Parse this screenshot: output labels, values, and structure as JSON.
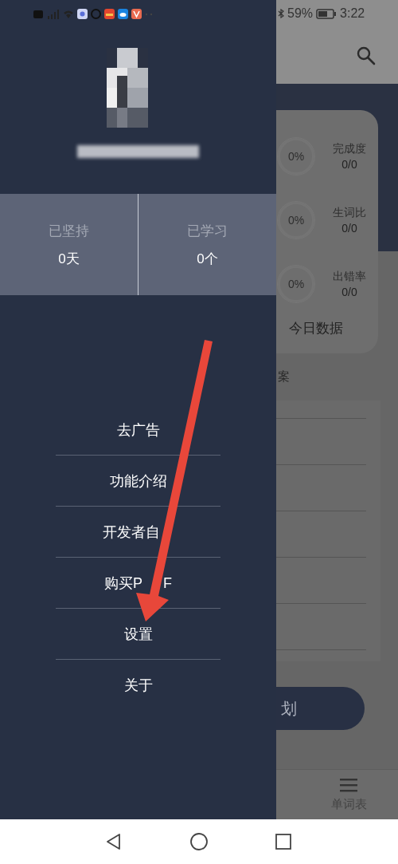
{
  "status_bar": {
    "battery": "59%",
    "time": "3:22"
  },
  "drawer": {
    "stats": [
      {
        "label": "已坚持",
        "value": "0天"
      },
      {
        "label": "已学习",
        "value": "0个"
      }
    ],
    "menu": [
      {
        "label": "去广告"
      },
      {
        "label": "功能介绍"
      },
      {
        "label": "开发者自",
        "trailing_gap": true
      },
      {
        "label": "购买P",
        "label_after_gap": "F"
      },
      {
        "label": "设置"
      },
      {
        "label": "关于"
      }
    ]
  },
  "background_screen": {
    "metrics": [
      {
        "reading": "0%",
        "label": "完成度",
        "value": "0/0"
      },
      {
        "reading": "0%",
        "label": "生词比",
        "value": "0/0"
      },
      {
        "reading": "0%",
        "label": "出错率",
        "value": "0/0"
      }
    ],
    "card_title": "今日数据",
    "section_title": "案",
    "button": "划",
    "bottom_tab": "单词表"
  }
}
